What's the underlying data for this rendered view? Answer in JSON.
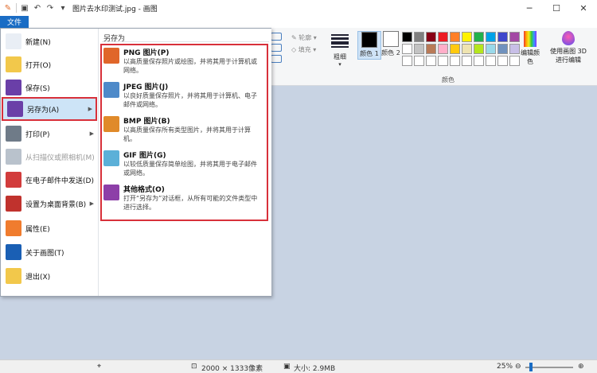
{
  "window": {
    "title": "图片去水印测试.jpg - 画图",
    "controls": [
      "─",
      "☐",
      "✕"
    ]
  },
  "quick_access": [
    "save-icon",
    "undo-icon",
    "redo-icon",
    "customize-icon"
  ],
  "ribbon": {
    "file_tab": "文件",
    "shape_options": [
      "轮廓",
      "填充"
    ],
    "size_label": "粗细",
    "color1_label": "颜色 1",
    "color2_label": "颜色 2",
    "edit_colors_label": "编辑颜色",
    "paint3d_label": "使用画图 3D 进行编辑",
    "colors_group_label": "颜色",
    "palette_row1": [
      "#000000",
      "#7f7f7f",
      "#880015",
      "#ed1c24",
      "#ff7f27",
      "#fff200",
      "#22b14c",
      "#00a2e8",
      "#3f48cc",
      "#a349a4"
    ],
    "palette_row2": [
      "#ffffff",
      "#c3c3c3",
      "#b97a57",
      "#ffaec9",
      "#ffc90e",
      "#efe4b0",
      "#b5e61d",
      "#99d9ea",
      "#7092be",
      "#c8bfe7"
    ],
    "palette_row3": [
      "#ffffff",
      "#ffffff",
      "#ffffff",
      "#ffffff",
      "#ffffff",
      "#ffffff",
      "#ffffff",
      "#ffffff",
      "#ffffff",
      "#ffffff"
    ]
  },
  "file_menu": {
    "items": [
      {
        "label": "新建(N)",
        "icon": "new-file-icon",
        "color": "#e9eef5",
        "arrow": false,
        "disabled": false
      },
      {
        "label": "打开(O)",
        "icon": "open-folder-icon",
        "color": "#f2c84b",
        "arrow": false,
        "disabled": false
      },
      {
        "label": "保存(S)",
        "icon": "save-disk-icon",
        "color": "#6a3fa8",
        "arrow": false,
        "disabled": false
      },
      {
        "label": "另存为(A)",
        "icon": "save-as-icon",
        "color": "#6a3fa8",
        "arrow": true,
        "disabled": false
      },
      {
        "label": "打印(P)",
        "icon": "printer-icon",
        "color": "#6f7b88",
        "arrow": true,
        "disabled": false
      },
      {
        "label": "从扫描仪或照相机(M)",
        "icon": "scanner-icon",
        "color": "#b9c2cc",
        "arrow": false,
        "disabled": true
      },
      {
        "label": "在电子邮件中发送(D)",
        "icon": "email-icon",
        "color": "#d23c3c",
        "arrow": false,
        "disabled": false
      },
      {
        "label": "设置为桌面背景(B)",
        "icon": "desktop-background-icon",
        "color": "#c0322d",
        "arrow": true,
        "disabled": false
      },
      {
        "label": "属性(E)",
        "icon": "checkmark-icon",
        "color": "#f07c2e",
        "arrow": false,
        "disabled": false
      },
      {
        "label": "关于画图(T)",
        "icon": "info-icon",
        "color": "#1a5fb4",
        "arrow": false,
        "disabled": false
      },
      {
        "label": "退出(X)",
        "icon": "exit-icon",
        "color": "#f2c84b",
        "arrow": false,
        "disabled": false
      }
    ],
    "submenu": {
      "heading": "另存为",
      "formats": [
        {
          "title": "PNG 图片(P)",
          "desc": "以高质量保存照片或绘图，并将其用于计算机或网络。",
          "icon": "png-icon",
          "color": "#e0662a"
        },
        {
          "title": "JPEG 图片(J)",
          "desc": "以良好质量保存照片，并将其用于计算机、电子邮件或网络。",
          "icon": "jpeg-icon",
          "color": "#4e8ac9"
        },
        {
          "title": "BMP 图片(B)",
          "desc": "以高质量保存所有类型图片，并将其用于计算机。",
          "icon": "bmp-icon",
          "color": "#e08a2a"
        },
        {
          "title": "GIF 图片(G)",
          "desc": "以较低质量保存简单绘图，并将其用于电子邮件或网络。",
          "icon": "gif-icon",
          "color": "#5bb0d8"
        },
        {
          "title": "其他格式(O)",
          "desc": "打开“另存为”对话框，从所有可能的文件类型中进行选择。",
          "icon": "other-formats-icon",
          "color": "#8d3fa8"
        }
      ]
    }
  },
  "status": {
    "dimensions": "2000 × 1333像素",
    "size": "大小: 2.9MB",
    "zoom": "25%",
    "zoom_fraction": 0.12
  }
}
